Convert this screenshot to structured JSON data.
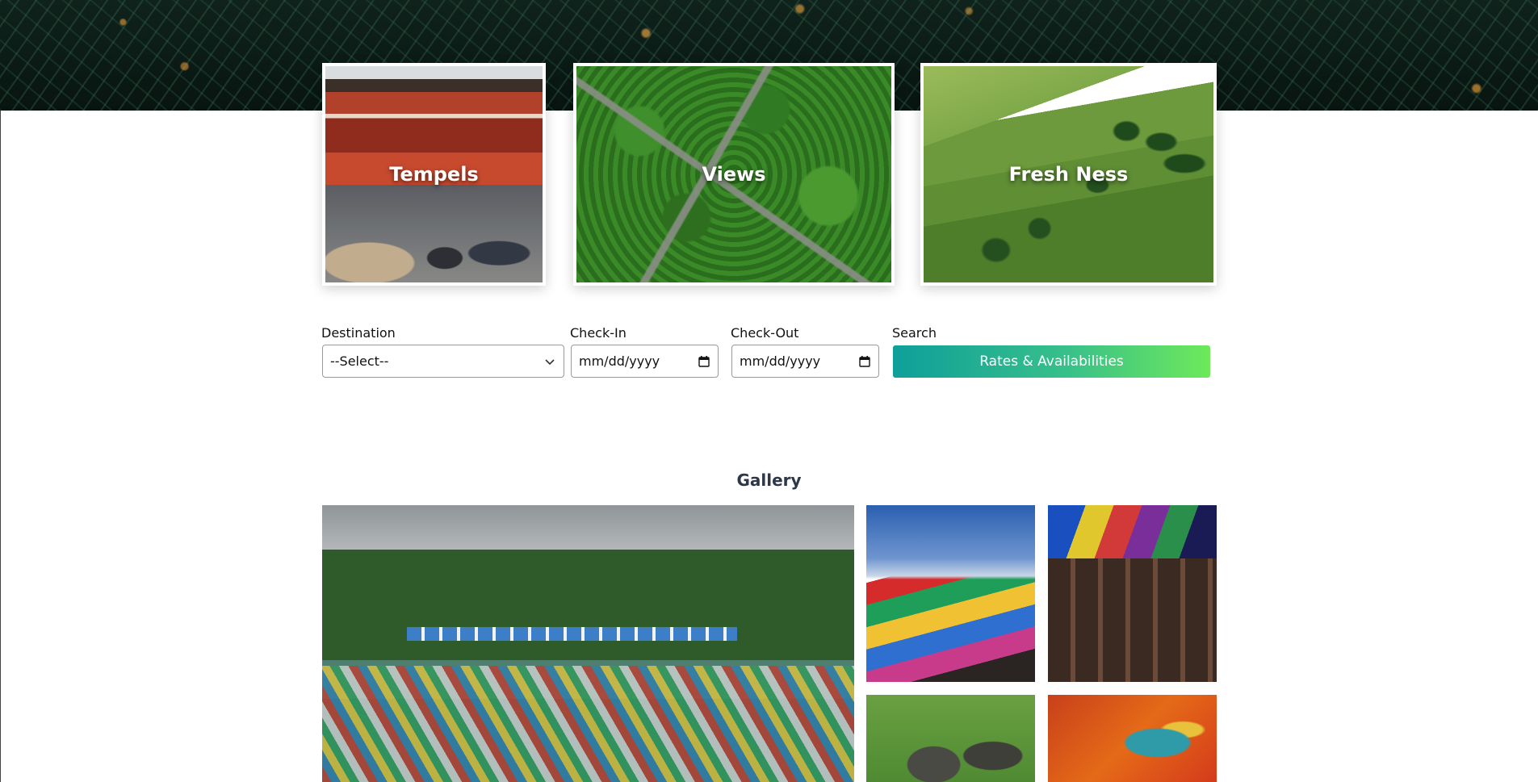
{
  "hero": {
    "image": "christmas-tree-banner"
  },
  "categories": [
    {
      "label": "Tempels",
      "image": "temple-gate-photo"
    },
    {
      "label": "Views",
      "image": "forest-road-aerial-photo"
    },
    {
      "label": "Fresh Ness",
      "image": "green-hills-photo"
    }
  ],
  "search_form": {
    "destination_label": "Destination",
    "destination_value": "--Select--",
    "checkin_label": "Check-In",
    "checkin_placeholder": "mm/dd/yyyy",
    "checkout_label": "Check-Out",
    "checkout_placeholder": "mm/dd/yyyy",
    "search_label": "Search",
    "search_button": "Rates & Availabilities",
    "button_gradient": [
      "#0e9f9a",
      "#6ee95a"
    ]
  },
  "gallery": {
    "title": "Gallery",
    "images": [
      "lake-boats-photo",
      "prayer-flags-mountain-photo",
      "prayer-wheels-photo",
      "elephant-ride-photo",
      "dragon-carving-photo"
    ]
  }
}
